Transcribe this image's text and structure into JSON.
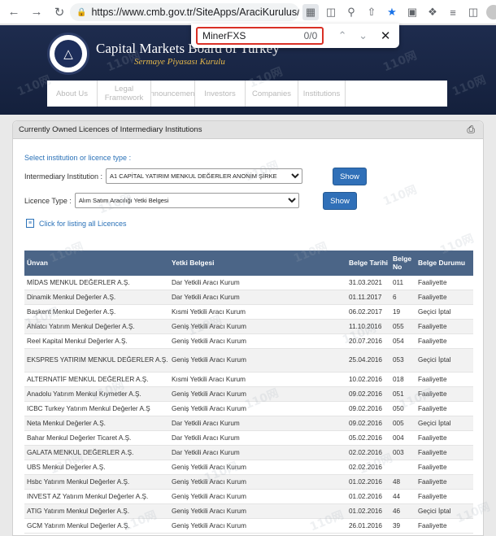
{
  "browser": {
    "url": "https://www.cmb.gov.tr/SiteApps/AraciKurulus/Ye...",
    "find_query": "MinerFXS",
    "find_count": "0/0"
  },
  "site": {
    "title": "Capital Markets Board of Turkey",
    "subtitle": "Sermaye Piyasası Kurulu",
    "nav": [
      "About Us",
      "Legal Framework",
      "Announcements",
      "Investors",
      "Companies",
      "Institutions",
      ""
    ]
  },
  "panel": {
    "title": "Currently Owned Licences of Intermediary Institutions",
    "select_hint": "Select institution or licence type :",
    "institution_label": "Intermediary Institution :",
    "institution_value": "A1 CAPİTAL YATIRIM MENKUL DEĞERLER ANONİM ŞİRKE",
    "licence_label": "Licence Type :",
    "licence_value": "Alım Satım Aracılığı Yetki Belgesi",
    "show_label": "Show",
    "list_all_label": "Click for listing all Licences"
  },
  "table": {
    "headers": [
      "Ünvan",
      "Yetki Belgesi",
      "Belge Tarihi",
      "Belge No",
      "Belge Durumu"
    ],
    "rows": [
      [
        "MİDAS MENKUL DEĞERLER A.Ş.",
        "Dar Yetkili Aracı Kurum",
        "31.03.2021",
        "011",
        "Faaliyette"
      ],
      [
        "Dinamik Menkul Değerler A.Ş.",
        "Dar Yetkili Aracı Kurum",
        "01.11.2017",
        "6",
        "Faaliyette"
      ],
      [
        "Başkent Menkul Değerler A.Ş.",
        "Kısmi Yetkili Aracı Kurum",
        "06.02.2017",
        "19",
        "Geçici İptal"
      ],
      [
        "Ahlatcı Yatırım Menkul Değerler A.Ş.",
        "Geniş Yetkili Aracı Kurum",
        "11.10.2016",
        "055",
        "Faaliyette"
      ],
      [
        "Reel Kapital Menkul Değerler A.Ş.",
        "Geniş Yetkili Aracı Kurum",
        "20.07.2016",
        "054",
        "Faaliyette"
      ],
      [
        "EKSPRES YATIRIM MENKUL DEĞERLER A.Ş.",
        "Geniş Yetkili Aracı Kurum",
        "25.04.2016",
        "053",
        "Geçici İptal"
      ],
      [
        "ALTERNATİF MENKUL DEĞERLER A.Ş.",
        "Kısmi Yetkili Aracı Kurum",
        "10.02.2016",
        "018",
        "Faaliyette"
      ],
      [
        "Anadolu Yatırım Menkul Kıymetler A.Ş.",
        "Geniş Yetkili Aracı Kurum",
        "09.02.2016",
        "051",
        "Faaliyette"
      ],
      [
        "ICBC Turkey Yatırım Menkul Değerler A.Ş",
        "Geniş Yetkili Aracı Kurum",
        "09.02.2016",
        "050",
        "Faaliyette"
      ],
      [
        "Neta Menkul Değerler A.Ş.",
        "Dar Yetkili Aracı Kurum",
        "09.02.2016",
        "005",
        "Geçici İptal"
      ],
      [
        "Bahar Menkul Değerler Ticaret A.Ş.",
        "Dar Yetkili Aracı Kurum",
        "05.02.2016",
        "004",
        "Faaliyette"
      ],
      [
        "GALATA MENKUL DEĞERLER A.Ş.",
        "Dar Yetkili Aracı Kurum",
        "02.02.2016",
        "003",
        "Faaliyette"
      ],
      [
        "UBS Menkul Değerler A.Ş.",
        "Geniş Yetkili Aracı Kurum",
        "02.02.2016",
        "",
        "Faaliyette"
      ],
      [
        "Hsbc Yatırım Menkul Değerler A.Ş.",
        "Geniş Yetkili Aracı Kurum",
        "01.02.2016",
        "48",
        "Faaliyette"
      ],
      [
        "INVEST AZ Yatırım Menkul Değerler A.Ş.",
        "Geniş Yetkili Aracı Kurum",
        "01.02.2016",
        "44",
        "Faaliyette"
      ],
      [
        "ATIG Yatırım Menkul Değerler A.Ş.",
        "Geniş Yetkili Aracı Kurum",
        "01.02.2016",
        "46",
        "Geçici İptal"
      ],
      [
        "GCM Yatırım Menkul Değerler A.Ş.",
        "Geniş Yetkili Aracı Kurum",
        "26.01.2016",
        "39",
        "Faaliyette"
      ]
    ]
  },
  "watermark": "110网"
}
